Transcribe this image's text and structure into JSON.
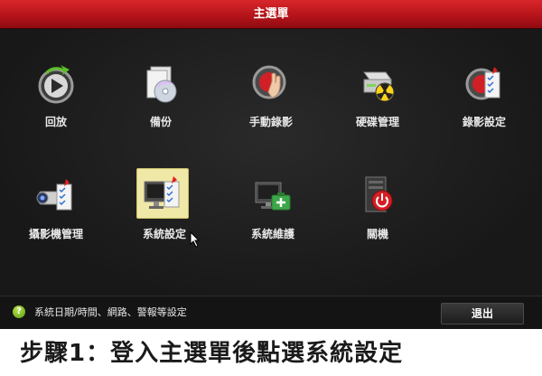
{
  "window": {
    "title": "主選單"
  },
  "menu": {
    "items": [
      {
        "label": "回放",
        "icon": "playback-icon"
      },
      {
        "label": "備份",
        "icon": "backup-icon"
      },
      {
        "label": "手動錄影",
        "icon": "manual-record-icon"
      },
      {
        "label": "硬碟管理",
        "icon": "hdd-management-icon"
      },
      {
        "label": "錄影設定",
        "icon": "record-settings-icon"
      },
      {
        "label": "攝影機管理",
        "icon": "camera-management-icon"
      },
      {
        "label": "系統設定",
        "icon": "system-settings-icon",
        "selected": true
      },
      {
        "label": "系統維護",
        "icon": "system-maintenance-icon"
      },
      {
        "label": "關機",
        "icon": "shutdown-icon"
      }
    ]
  },
  "status": {
    "text": "系統日期/時間、網路、警報等設定",
    "icon": "help-icon"
  },
  "buttons": {
    "exit_label": "退出"
  },
  "caption": "步驟1：登入主選單後點選系統設定",
  "colors": {
    "title_bar": "#c41b21",
    "background": "#1a1a1a",
    "selected_tile": "#efe8a6",
    "caption_text": "#1a1a1a"
  }
}
